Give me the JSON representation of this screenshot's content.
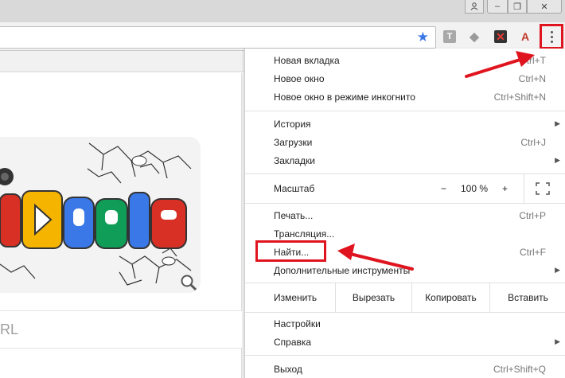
{
  "menu": {
    "items": [
      {
        "label": "Новая вкладка",
        "shortcut": "Ctrl+T"
      },
      {
        "label": "Новое окно",
        "shortcut": "Ctrl+N"
      },
      {
        "label": "Новое окно в режиме инкогнито",
        "shortcut": "Ctrl+Shift+N"
      },
      {
        "label": "История",
        "shortcut": ""
      },
      {
        "label": "Загрузки",
        "shortcut": "Ctrl+J"
      },
      {
        "label": "Закладки",
        "shortcut": ""
      },
      {
        "label": "Печать...",
        "shortcut": "Ctrl+P"
      },
      {
        "label": "Трансляция...",
        "shortcut": ""
      },
      {
        "label": "Найти...",
        "shortcut": "Ctrl+F"
      },
      {
        "label": "Дополнительные инструменты",
        "shortcut": ""
      },
      {
        "label": "Настройки",
        "shortcut": ""
      },
      {
        "label": "Справка",
        "shortcut": ""
      },
      {
        "label": "Выход",
        "shortcut": "Ctrl+Shift+Q"
      }
    ],
    "zoom": {
      "label": "Масштаб",
      "minus": "−",
      "value": "100 %",
      "plus": "+"
    },
    "edit": {
      "label": "Изменить",
      "cut": "Вырезать",
      "copy": "Копировать",
      "paste": "Вставить"
    }
  },
  "page": {
    "search_hint": "RL"
  },
  "extensions": {
    "t": "T",
    "d": "◆",
    "x": "✕",
    "pdf": "A"
  },
  "titlebar": {
    "user_icon": "person-icon",
    "min": "–",
    "max": "❐",
    "close": "✕"
  },
  "colors": {
    "highlight": "#e0141e",
    "star": "#3b78e7"
  }
}
